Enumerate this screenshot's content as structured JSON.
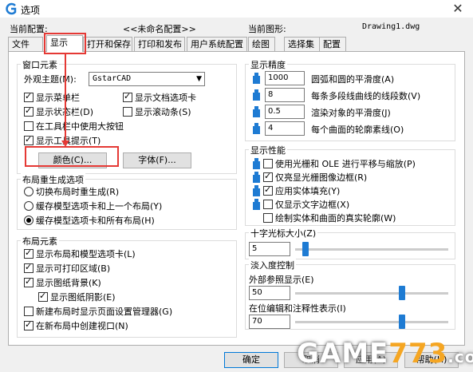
{
  "window": {
    "title": "选项"
  },
  "config": {
    "current_config_label": "当前配置:",
    "current_config_value": "<<未命名配置>>",
    "current_drawing_label": "当前图形:",
    "current_drawing_value": "Drawing1.dwg"
  },
  "tabs": [
    {
      "label": "文件"
    },
    {
      "label": "显示"
    },
    {
      "label": "打开和保存"
    },
    {
      "label": "打印和发布"
    },
    {
      "label": "用户系统配置"
    },
    {
      "label": "绘图"
    },
    {
      "label": "选择集"
    },
    {
      "label": "配置"
    }
  ],
  "window_elements": {
    "title": "窗口元素",
    "theme_label": "外观主题(M):",
    "theme_value": "GstarCAD",
    "checkboxes": [
      {
        "label": "显示菜单栏",
        "checked": true
      },
      {
        "label": "显示文档选项卡",
        "checked": true
      },
      {
        "label": "显示状态栏(D)",
        "checked": true
      },
      {
        "label": "显示滚动条(S)",
        "checked": false
      },
      {
        "label": "在工具栏中使用大按钮",
        "checked": false
      },
      {
        "label": "显示工具提示(T)",
        "checked": true
      }
    ],
    "color_button": "颜色(C)...",
    "font_button": "字体(F)..."
  },
  "layout_regen": {
    "title": "布局重生成选项",
    "radios": [
      {
        "label": "切换布局时重生成(R)",
        "checked": false
      },
      {
        "label": "缓存模型选项卡和上一个布局(Y)",
        "checked": false
      },
      {
        "label": "缓存模型选项卡和所有布局(H)",
        "checked": true
      }
    ]
  },
  "layout_elements": {
    "title": "布局元素",
    "checkboxes": [
      {
        "label": "显示布局和模型选项卡(L)",
        "checked": true
      },
      {
        "label": "显示可打印区域(B)",
        "checked": true
      },
      {
        "label": "显示图纸背景(K)",
        "checked": true
      },
      {
        "label": "显示图纸阴影(E)",
        "checked": true
      },
      {
        "label": "新建布局时显示页面设置管理器(G)",
        "checked": false
      },
      {
        "label": "在新布局中创建视口(N)",
        "checked": true
      }
    ]
  },
  "display_precision": {
    "title": "显示精度",
    "rows": [
      {
        "value": "1000",
        "label": "圆弧和圆的平滑度(A)"
      },
      {
        "value": "8",
        "label": "每条多段线曲线的线段数(V)"
      },
      {
        "value": "0.5",
        "label": "渲染对象的平滑度(J)"
      },
      {
        "value": "4",
        "label": "每个曲面的轮廓素线(O)"
      }
    ]
  },
  "display_performance": {
    "title": "显示性能",
    "checkboxes": [
      {
        "label": "使用光栅和 OLE 进行平移与缩放(P)",
        "checked": false
      },
      {
        "label": "仅亮显光栅图像边框(R)",
        "checked": true
      },
      {
        "label": "应用实体填充(Y)",
        "checked": true
      },
      {
        "label": "仅显示文字边框(X)",
        "checked": false
      },
      {
        "label": "绘制实体和曲面的真实轮廓(W)",
        "checked": false
      }
    ]
  },
  "crosshair": {
    "title": "十字光标大小(Z)",
    "value": "5",
    "level": 5
  },
  "fade": {
    "title": "淡入度控制",
    "xref_label": "外部参照显示(E)",
    "xref_value": "50",
    "xref_level": 50,
    "inplace_label": "在位编辑和注释性表示(I)",
    "inplace_value": "70",
    "inplace_level": 70
  },
  "buttons": {
    "ok": "确定",
    "cancel": "取消",
    "apply": "应用(A)",
    "help": "帮助(H)"
  },
  "watermark": {
    "part1": "GAME",
    "part2": "773",
    "part3": ".com"
  },
  "colors": {
    "accent": "#1e7bd3",
    "highlight": "#e53935",
    "watermark": "#f5a623"
  }
}
